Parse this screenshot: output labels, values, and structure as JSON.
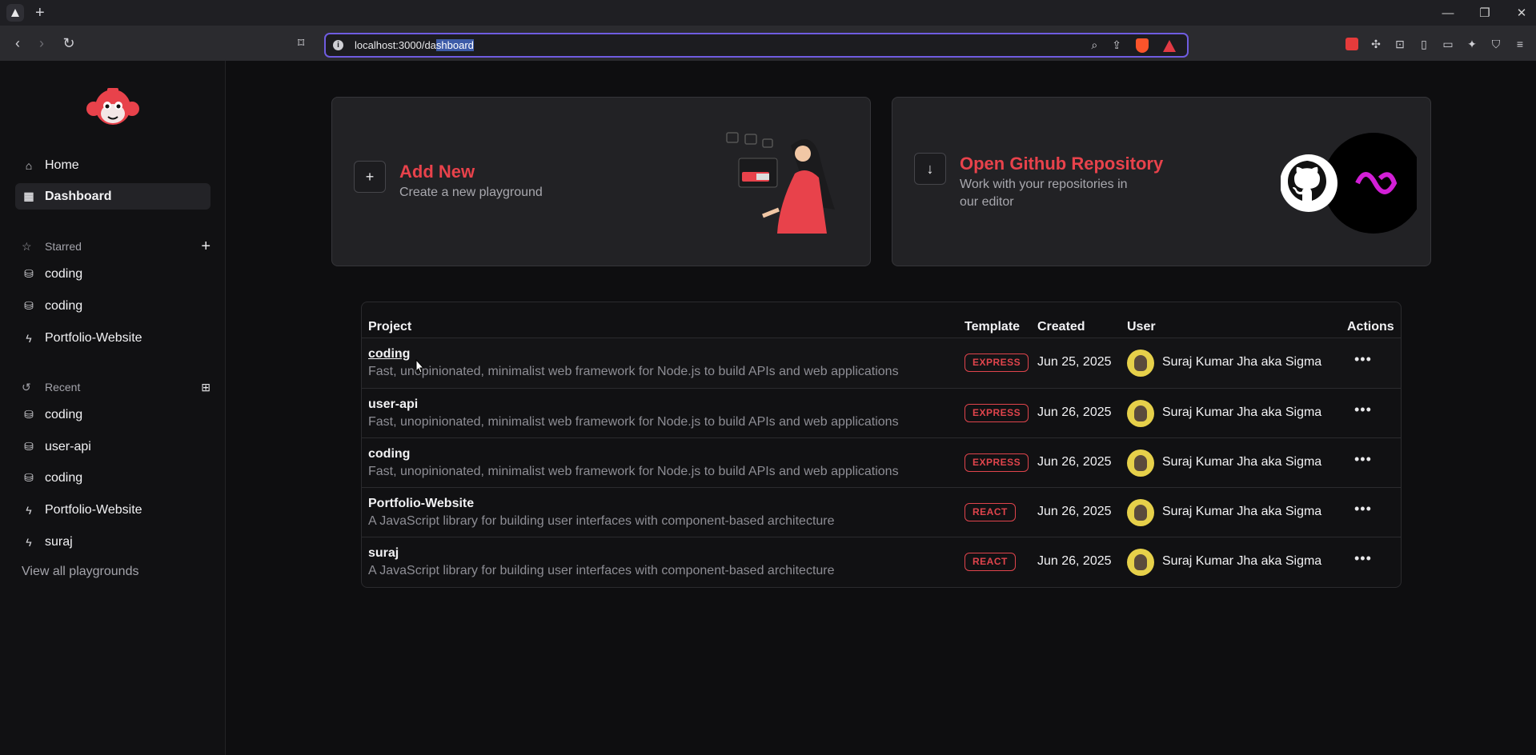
{
  "browser": {
    "new_tab_symbol": "+",
    "url_plain": "localhost:3000/da",
    "url_selected": "shboard"
  },
  "sidebar": {
    "nav": [
      {
        "label": "Home",
        "icon": "home-icon"
      },
      {
        "label": "Dashboard",
        "icon": "grid-icon"
      }
    ],
    "starred_heading": "Starred",
    "starred": [
      {
        "label": "coding",
        "icon": "database-icon"
      },
      {
        "label": "coding",
        "icon": "database-icon"
      },
      {
        "label": "Portfolio-Website",
        "icon": "zap-icon"
      }
    ],
    "recent_heading": "Recent",
    "recent": [
      {
        "label": "coding",
        "icon": "database-icon"
      },
      {
        "label": "user-api",
        "icon": "database-icon"
      },
      {
        "label": "coding",
        "icon": "database-icon"
      },
      {
        "label": "Portfolio-Website",
        "icon": "zap-icon"
      },
      {
        "label": "suraj",
        "icon": "zap-icon"
      }
    ],
    "view_all": "View all playgrounds"
  },
  "cards": {
    "add": {
      "title": "Add New",
      "description": "Create a new playground"
    },
    "github": {
      "title": "Open Github Repository",
      "description_line1": "Work with your repositories in",
      "description_line2": "our editor"
    }
  },
  "table": {
    "headers": {
      "project": "Project",
      "template": "Template",
      "created": "Created",
      "user": "User",
      "actions": "Actions"
    },
    "rows": [
      {
        "name": "coding",
        "description": "Fast, unopinionated, minimalist web framework for Node.js to build APIs and web applications",
        "template": "EXPRESS",
        "created": "Jun 25, 2025",
        "user": "Suraj Kumar Jha aka Sigma",
        "actions": "•••"
      },
      {
        "name": "user-api",
        "description": "Fast, unopinionated, minimalist web framework for Node.js to build APIs and web applications",
        "template": "EXPRESS",
        "created": "Jun 26, 2025",
        "user": "Suraj Kumar Jha aka Sigma",
        "actions": "•••"
      },
      {
        "name": "coding",
        "description": "Fast, unopinionated, minimalist web framework for Node.js to build APIs and web applications",
        "template": "EXPRESS",
        "created": "Jun 26, 2025",
        "user": "Suraj Kumar Jha aka Sigma",
        "actions": "•••"
      },
      {
        "name": "Portfolio-Website",
        "description": "A JavaScript library for building user interfaces with component-based architecture",
        "template": "REACT",
        "created": "Jun 26, 2025",
        "user": "Suraj Kumar Jha aka Sigma",
        "actions": "•••"
      },
      {
        "name": "suraj",
        "description": "A JavaScript library for building user interfaces with component-based architecture",
        "template": "REACT",
        "created": "Jun 26, 2025",
        "user": "Suraj Kumar Jha aka Sigma",
        "actions": "•••"
      }
    ]
  },
  "colors": {
    "accent": "#e8424b",
    "background": "#0e0e10",
    "card": "#222225"
  }
}
